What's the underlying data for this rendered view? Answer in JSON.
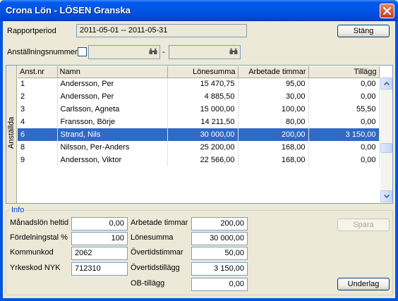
{
  "window": {
    "title": "Crona Lön - LÖSEN Granska",
    "close_icon": "close-icon"
  },
  "top": {
    "period_label": "Rapportperiod",
    "period_value": "2011-05-01 -- 2011-05-31",
    "close_button": "Stäng",
    "employee_label": "Anställningsnummer",
    "employee_from": "",
    "employee_to": "",
    "range_separator": "-",
    "finder_icon": "binoculars-icon"
  },
  "grid": {
    "side_label": "Anställda",
    "columns": [
      "Anst.nr",
      "Namn",
      "Lönesumma",
      "Arbetade timmar",
      "Tillägg"
    ],
    "rows": [
      [
        "1",
        "Andersson, Per",
        "15 470,75",
        "95,00",
        "0,00"
      ],
      [
        "2",
        "Andersson, Per",
        "4 885,50",
        "30,00",
        "0,00"
      ],
      [
        "3",
        "Carlsson, Agneta",
        "15 000,00",
        "100,00",
        "55,50"
      ],
      [
        "4",
        "Fransson, Börje",
        "14 211,50",
        "80,00",
        "0,00"
      ],
      [
        "6",
        "Strand, Nils",
        "30 000,00",
        "200,00",
        "3 150,00"
      ],
      [
        "8",
        "Nilsson, Per-Anders",
        "25 200,00",
        "168,00",
        "0,00"
      ],
      [
        "9",
        "Andersson, Viktor",
        "22 566,00",
        "168,00",
        "0,00"
      ]
    ],
    "selected_row": 4
  },
  "info": {
    "title": "Info",
    "monthly_salary_label": "Månadslön heltid",
    "monthly_salary_value": "0,00",
    "distribution_label": "Fördelningstal %",
    "distribution_value": "100",
    "municipality_label": "Kommunkod",
    "municipality_value": "2062",
    "occupation_label": "Yrkeskod NYK",
    "occupation_value": "712310",
    "worked_hours_label": "Arbetade timmar",
    "worked_hours_value": "200,00",
    "salary_sum_label": "Lönesumma",
    "salary_sum_value": "30 000,00",
    "overtime_hours_label": "Övertidstimmar",
    "overtime_hours_value": "50,00",
    "overtime_supplement_label": "Övertidstillägg",
    "overtime_supplement_value": "3 150,00",
    "ob_supplement_label": "OB-tillägg",
    "ob_supplement_value": "0,00",
    "save_button": "Spara",
    "basis_button": "Underlag"
  },
  "colors": {
    "title_bar": "#0055e5",
    "selection": "#316ac5",
    "group_title": "#0046d5"
  }
}
